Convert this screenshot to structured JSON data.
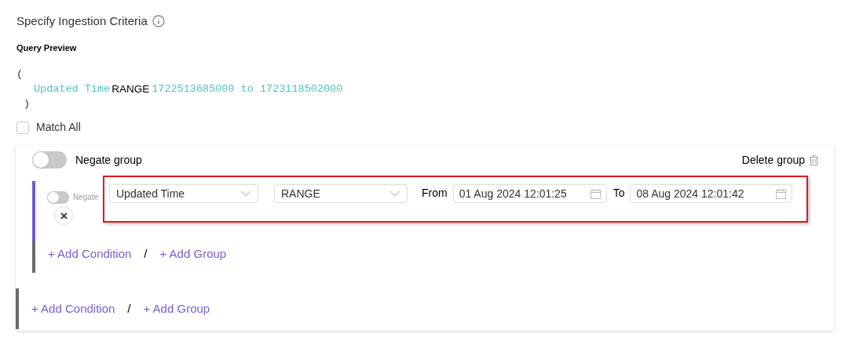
{
  "title": "Specify Ingestion Criteria",
  "query_preview": {
    "label": "Query Preview",
    "open": "(",
    "field": "Updated Time",
    "operator": "RANGE",
    "value": "1722513685000 to 1723118502000",
    "close": ")"
  },
  "match_all": {
    "label": "Match All",
    "checked": false
  },
  "group": {
    "negate": {
      "label": "Negate group",
      "on": false
    },
    "delete_label": "Delete group",
    "conditions": [
      {
        "negate": {
          "label": "Negate",
          "on": false
        },
        "field": "Updated Time",
        "operator": "RANGE",
        "from_label": "From",
        "from": "01 Aug 2024 12:01:25",
        "to_label": "To",
        "to": "08 Aug 2024 12:01:42",
        "highlighted": true
      }
    ],
    "actions": {
      "add_condition": "+ Add Condition",
      "separator": "/",
      "add_group": "+ Add Group"
    }
  },
  "actions": {
    "add_condition": "+ Add Condition",
    "separator": "/",
    "add_group": "+ Add Group"
  }
}
